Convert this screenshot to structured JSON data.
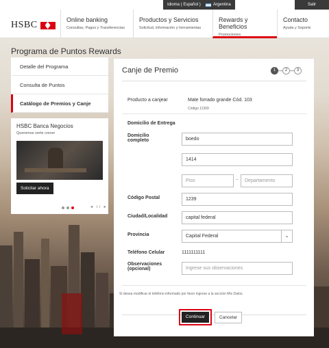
{
  "topbar": {
    "language": "Idioma ( Español )",
    "country": "Argentina",
    "logout": "Salir"
  },
  "header": {
    "logo": "HSBC",
    "nav": [
      {
        "title": "Online banking",
        "subtitle": "Consultas, Pagos y Transferencias"
      },
      {
        "title": "Productos y Servicios",
        "subtitle": "Solicitud, información y herramientas"
      },
      {
        "title": "Rewards y Beneficios",
        "subtitle": "Promociones"
      },
      {
        "title": "Contacto",
        "subtitle": "Ayuda y Soporte"
      }
    ]
  },
  "page_title": "Programa de Puntos Rewards",
  "sidebar": {
    "items": [
      {
        "label": "Detalle del Programa"
      },
      {
        "label": "Consulta de Puntos"
      },
      {
        "label": "Catálogo de Premios y Canje"
      }
    ]
  },
  "promo": {
    "title": "HSBC Banca Negocios",
    "subtitle": "Queremos verte crecer",
    "button": "Solicitar ahora",
    "controls": "◂ ıı ▸"
  },
  "panel": {
    "title": "Canje de Premio",
    "steps": [
      "1",
      "2",
      "3"
    ],
    "product_label": "Producto a canjear",
    "product_value": "Mate forrado grande  Cód. 103",
    "product_code": "Código 11309",
    "section_title": "Domicilio de Entrega",
    "address_label": "Domicilio completo",
    "street": "boedo",
    "number": "1414",
    "floor_placeholder": "Piso",
    "apartment_placeholder": "Departamento",
    "postal_label": "Código Postal",
    "postal_value": "1239",
    "city_label": "Ciudad/Localidad",
    "city_value": "capital federal",
    "province_label": "Provincia",
    "province_value": "Capital Federal",
    "phone_label": "Teléfono Celular",
    "phone_value": "1111111111",
    "obs_label": "Observaciones (opcional)",
    "obs_placeholder": "Ingrese sus observaciones",
    "note": "Si desea modificar el teléfono informado por favor ingrese a la sección Mis Datos.",
    "continue_button": "Continuar",
    "cancel_button": "Cancelar"
  }
}
